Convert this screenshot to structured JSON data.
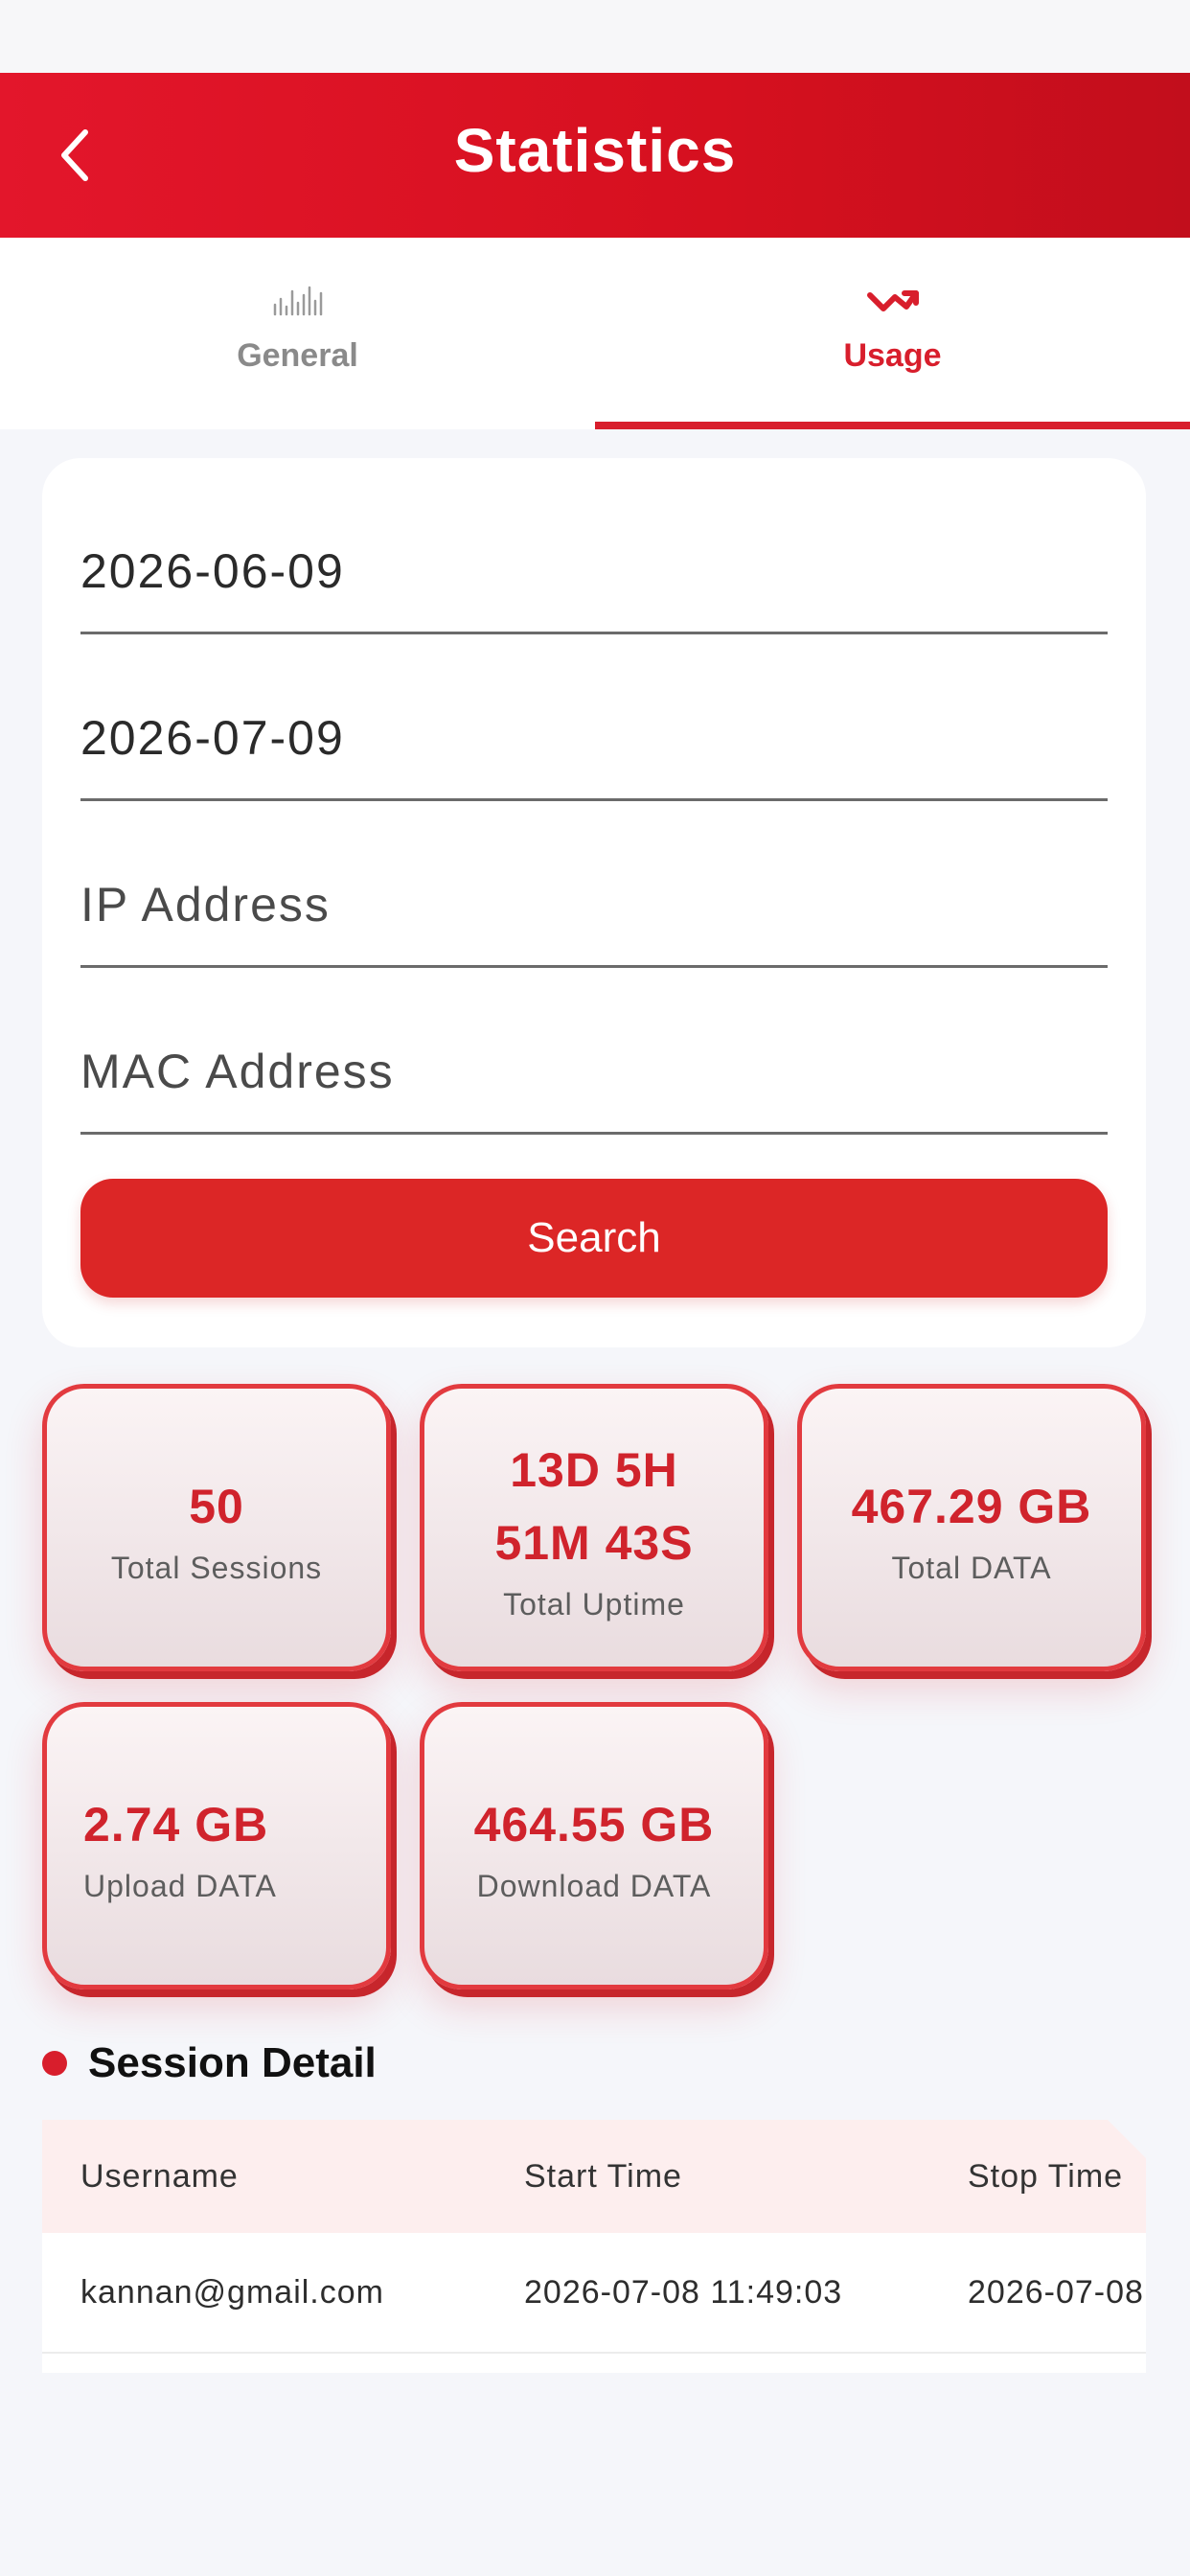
{
  "header": {
    "title": "Statistics"
  },
  "tabs": [
    {
      "label": "General",
      "icon": "bar-chart-icon",
      "active": false
    },
    {
      "label": "Usage",
      "icon": "trend-icon",
      "active": true
    }
  ],
  "form": {
    "start_date": "2026-06-09",
    "end_date": "2026-07-09",
    "ip_placeholder": "IP Address",
    "mac_placeholder": "MAC Address",
    "search_label": "Search"
  },
  "stats": {
    "total_sessions": {
      "value": "50",
      "label": "Total Sessions"
    },
    "total_uptime": {
      "value_line1": "13D 5H",
      "value_line2": "51M 43S",
      "label": "Total Uptime"
    },
    "total_data": {
      "value": "467.29 GB",
      "label": "Total DATA"
    },
    "upload_data": {
      "value": "2.74 GB",
      "label": "Upload DATA"
    },
    "download_data": {
      "value": "464.55 GB",
      "label": "Download DATA"
    }
  },
  "session_detail": {
    "title": "Session Detail",
    "columns": [
      "Username",
      "Start Time",
      "Stop Time"
    ],
    "rows": [
      [
        "kannan@gmail.com",
        "2026-07-08 11:49:03",
        "2026-07-08"
      ]
    ]
  },
  "colors": {
    "accent": "#d81e2c",
    "header": "#e3162b",
    "button": "#dc2626"
  }
}
